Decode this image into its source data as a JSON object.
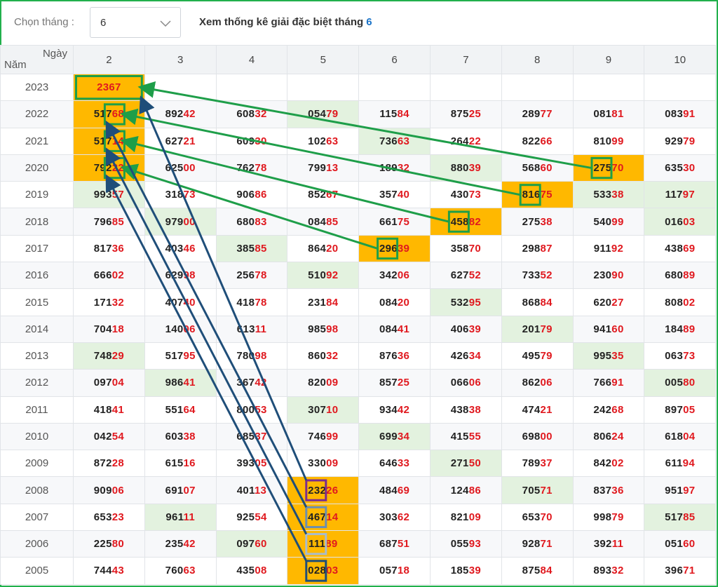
{
  "header": {
    "month_label": "Chọn tháng :",
    "month_value": "6",
    "title": "Xem thống kê giải đặc biệt tháng",
    "title_month": "6"
  },
  "table": {
    "corner_day": "Ngày",
    "corner_year": "Năm",
    "days": [
      "2",
      "3",
      "4",
      "5",
      "6",
      "7",
      "8",
      "9",
      "10"
    ],
    "rows": [
      {
        "year": "2023",
        "cells": [
          "2367",
          "",
          "",
          "",
          "",
          "",
          "",
          "",
          ""
        ]
      },
      {
        "year": "2022",
        "cells": [
          "51768",
          "89242",
          "60832",
          "05479",
          "11584",
          "87525",
          "28977",
          "08181",
          "08391"
        ]
      },
      {
        "year": "2021",
        "cells": [
          "51714",
          "62721",
          "60930",
          "10263",
          "73663",
          "26422",
          "82266",
          "81099",
          "92979"
        ]
      },
      {
        "year": "2020",
        "cells": [
          "79222",
          "62500",
          "76278",
          "79913",
          "18932",
          "88039",
          "56860",
          "27570",
          "63530"
        ]
      },
      {
        "year": "2019",
        "cells": [
          "99357",
          "31873",
          "90686",
          "85267",
          "35740",
          "43073",
          "81675",
          "53338",
          "11797"
        ]
      },
      {
        "year": "2018",
        "cells": [
          "79685",
          "97900",
          "68083",
          "08485",
          "66175",
          "45882",
          "27538",
          "54099",
          "01603"
        ]
      },
      {
        "year": "2017",
        "cells": [
          "81736",
          "40346",
          "38585",
          "86420",
          "29639",
          "35870",
          "29887",
          "91192",
          "43869"
        ]
      },
      {
        "year": "2016",
        "cells": [
          "66602",
          "62998",
          "25678",
          "51092",
          "34206",
          "62752",
          "73352",
          "23090",
          "68089"
        ]
      },
      {
        "year": "2015",
        "cells": [
          "17132",
          "40740",
          "41878",
          "23184",
          "08420",
          "53295",
          "86884",
          "62027",
          "80802"
        ]
      },
      {
        "year": "2014",
        "cells": [
          "70418",
          "14006",
          "61311",
          "98598",
          "08441",
          "40639",
          "20179",
          "94160",
          "18489"
        ]
      },
      {
        "year": "2013",
        "cells": [
          "74829",
          "51795",
          "78098",
          "86032",
          "87636",
          "42634",
          "49579",
          "99535",
          "06373"
        ]
      },
      {
        "year": "2012",
        "cells": [
          "09704",
          "98641",
          "36742",
          "82009",
          "85725",
          "06606",
          "86206",
          "76691",
          "00580"
        ]
      },
      {
        "year": "2011",
        "cells": [
          "41841",
          "55164",
          "80053",
          "30710",
          "93442",
          "43838",
          "47421",
          "24268",
          "89705"
        ]
      },
      {
        "year": "2010",
        "cells": [
          "04254",
          "60338",
          "68537",
          "74699",
          "69934",
          "41555",
          "69800",
          "80624",
          "61804"
        ]
      },
      {
        "year": "2009",
        "cells": [
          "87228",
          "61516",
          "39305",
          "33009",
          "64633",
          "27150",
          "78937",
          "84202",
          "61194"
        ]
      },
      {
        "year": "2008",
        "cells": [
          "90906",
          "69107",
          "40113",
          "23226",
          "48469",
          "12486",
          "70571",
          "83736",
          "95197"
        ]
      },
      {
        "year": "2007",
        "cells": [
          "65323",
          "96111",
          "92554",
          "46714",
          "30362",
          "82109",
          "65370",
          "99879",
          "51785"
        ]
      },
      {
        "year": "2006",
        "cells": [
          "22580",
          "23542",
          "09760",
          "11189",
          "68751",
          "05593",
          "92871",
          "39211",
          "05160"
        ]
      },
      {
        "year": "2005",
        "cells": [
          "74443",
          "76063",
          "43508",
          "02803",
          "05718",
          "18539",
          "87584",
          "89332",
          "39671"
        ]
      }
    ],
    "highlights_green": [
      [
        1,
        3
      ],
      [
        2,
        4
      ],
      [
        3,
        5
      ],
      [
        4,
        0
      ],
      [
        4,
        7
      ],
      [
        4,
        8
      ],
      [
        5,
        1
      ],
      [
        5,
        8
      ],
      [
        6,
        2
      ],
      [
        7,
        3
      ],
      [
        8,
        5
      ],
      [
        9,
        6
      ],
      [
        10,
        0
      ],
      [
        10,
        7
      ],
      [
        11,
        1
      ],
      [
        11,
        8
      ],
      [
        12,
        3
      ],
      [
        13,
        4
      ],
      [
        14,
        5
      ],
      [
        15,
        6
      ],
      [
        16,
        1
      ],
      [
        16,
        8
      ],
      [
        17,
        2
      ]
    ],
    "highlights_orange": [
      [
        0,
        0
      ],
      [
        1,
        0
      ],
      [
        2,
        0
      ],
      [
        3,
        0
      ],
      [
        3,
        7
      ],
      [
        4,
        6
      ],
      [
        5,
        5
      ],
      [
        6,
        4
      ],
      [
        15,
        3
      ],
      [
        16,
        3
      ],
      [
        17,
        3
      ],
      [
        18,
        3
      ]
    ]
  },
  "colors": {
    "accent_green": "#1e9e49",
    "arrow_navy": "#1f4e79",
    "highlight_orange": "#ffb800",
    "highlight_green": "#e3f2df",
    "digit_red": "#e0191f",
    "month_blue": "#1a73c8"
  }
}
